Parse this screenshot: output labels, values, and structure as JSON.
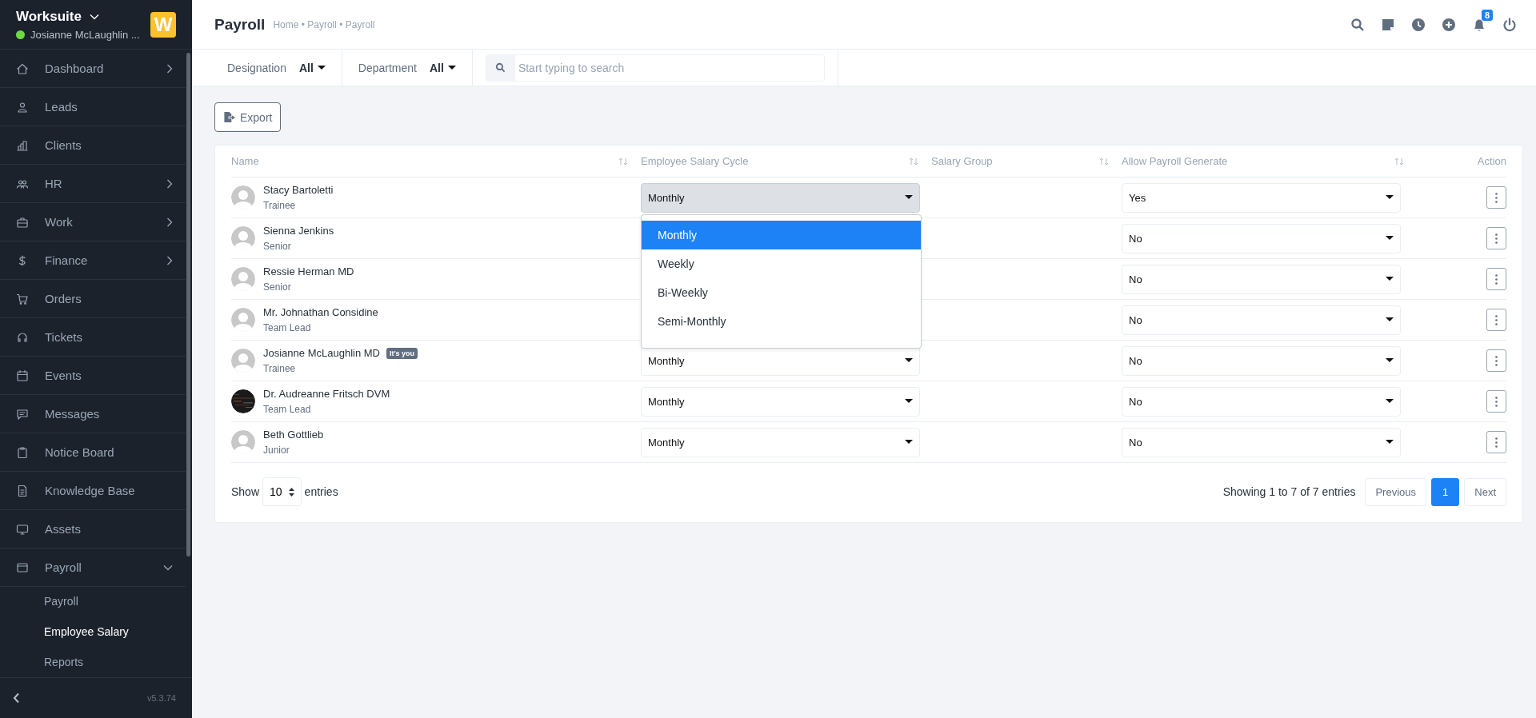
{
  "sidebar": {
    "brand": "Worksuite",
    "user": "Josianne McLaughlin ...",
    "user_online": true,
    "logo": "W",
    "items": [
      {
        "label": "Dashboard",
        "kind": "group",
        "expanded": false
      },
      {
        "label": "Leads",
        "kind": "link"
      },
      {
        "label": "Clients",
        "kind": "link"
      },
      {
        "label": "HR",
        "kind": "group",
        "expanded": false
      },
      {
        "label": "Work",
        "kind": "group",
        "expanded": false
      },
      {
        "label": "Finance",
        "kind": "group",
        "expanded": false
      },
      {
        "label": "Orders",
        "kind": "link"
      },
      {
        "label": "Tickets",
        "kind": "link"
      },
      {
        "label": "Events",
        "kind": "link"
      },
      {
        "label": "Messages",
        "kind": "link"
      },
      {
        "label": "Notice Board",
        "kind": "link"
      },
      {
        "label": "Knowledge Base",
        "kind": "link"
      },
      {
        "label": "Assets",
        "kind": "link"
      },
      {
        "label": "Payroll",
        "kind": "group",
        "expanded": true,
        "children": [
          {
            "label": "Payroll",
            "selected": false
          },
          {
            "label": "Employee Salary",
            "selected": true
          },
          {
            "label": "Reports",
            "selected": false
          }
        ]
      }
    ],
    "version": "v5.3.74"
  },
  "header": {
    "title": "Payroll",
    "breadcrumb": "Home • Payroll • Payroll",
    "notification_count": "8"
  },
  "filters": [
    {
      "label": "Designation",
      "value": "All"
    },
    {
      "label": "Department",
      "value": "All"
    }
  ],
  "search": {
    "placeholder": "Start typing to search"
  },
  "export_button": "Export",
  "table": {
    "columns": [
      {
        "label": "Name",
        "sortable": true
      },
      {
        "label": "Employee Salary Cycle",
        "sortable": true
      },
      {
        "label": "Salary Group",
        "sortable": true
      },
      {
        "label": "Allow Payroll Generate",
        "sortable": true
      },
      {
        "label": "Action",
        "sortable": false
      }
    ],
    "rows": [
      {
        "name": "Stacy Bartoletti",
        "role": "Trainee",
        "kind": "default",
        "salary_cycle": "Monthly",
        "menu_open": true,
        "allow_payroll": "Yes"
      },
      {
        "name": "Sienna Jenkins",
        "role": "Senior",
        "kind": "default",
        "menu_open": false,
        "allow_payroll": "No"
      },
      {
        "name": "Ressie Herman MD",
        "role": "Senior",
        "kind": "default",
        "menu_open": false,
        "allow_payroll": "No"
      },
      {
        "name": "Mr. Johnathan Considine",
        "role": "Team Lead",
        "kind": "default",
        "menu_open": false,
        "allow_payroll": "No"
      },
      {
        "name": "Josianne McLaughlin MD",
        "badge": "It's you",
        "role": "Trainee",
        "kind": "default",
        "salary_cycle": "Monthly",
        "menu_open": false,
        "allow_payroll": "No"
      },
      {
        "name": "Dr. Audreanne Fritsch DVM",
        "role": "Team Lead",
        "salary_cycle": "Monthly",
        "menu_open": false,
        "allow_payroll": "No"
      },
      {
        "name": "Beth Gottlieb",
        "role": "Junior",
        "kind": "default",
        "salary_cycle": "Monthly",
        "menu_open": false,
        "allow_payroll": "No"
      }
    ],
    "cycle_menu": {
      "options": [
        {
          "label": "Monthly",
          "selected": true
        },
        {
          "label": "Weekly",
          "selected": false
        },
        {
          "label": "Bi-Weekly",
          "selected": false
        },
        {
          "label": "Semi-Monthly",
          "selected": false
        }
      ]
    }
  },
  "footer": {
    "show_label": "Show",
    "page_size": "10",
    "entries_label": "entries",
    "info": "Showing 1 to 7 of 7 entries",
    "previous": "Previous",
    "pages": [
      {
        "label": "1",
        "selected": true
      }
    ],
    "next": "Next"
  }
}
